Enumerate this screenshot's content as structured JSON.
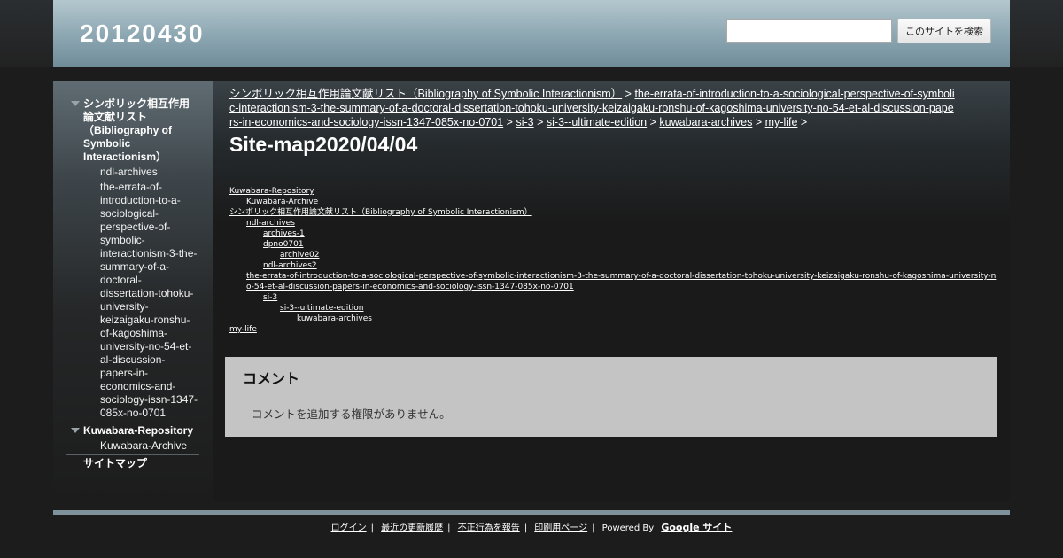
{
  "header": {
    "site_title": "20120430",
    "search_value": "",
    "search_button": "このサイトを検索"
  },
  "sidebar": {
    "items": [
      {
        "label": "シンボリック相互作用論文献リスト（Bibliography of Symbolic Interactionism）",
        "expanded": true,
        "children": [
          "ndl-archives",
          "the-errata-of-introduction-to-a-sociological-perspective-of-symbolic-interactionism-3-the-summary-of-a-doctoral-dissertation-tohoku-university-keizaigaku-ronshu-of-kagoshima-university-no-54-et-al-discussion-papers-in-economics-and-sociology-issn-1347-085x-no-0701"
        ]
      },
      {
        "label": "Kuwabara-Repository",
        "expanded": true,
        "children": [
          "Kuwabara-Archive"
        ]
      },
      {
        "label": "サイトマップ",
        "expanded": false,
        "children": []
      }
    ]
  },
  "breadcrumb": {
    "links": [
      "シンボリック相互作用論文献リスト（Bibliography of Symbolic Interactionism）",
      "the-errata-of-introduction-to-a-sociological-perspective-of-symbolic-interactionism-3-the-summary-of-a-doctoral-dissertation-tohoku-university-keizaigaku-ronshu-of-kagoshima-university-no-54-et-al-discussion-papers-in-economics-and-sociology-issn-1347-085x-no-0701",
      "si-3",
      "si-3--ultimate-edition",
      "kuwabara-archives",
      "my-life"
    ],
    "separator": ">"
  },
  "page_title": "Site-map2020/04/04",
  "sitemap": [
    {
      "label": "Kuwabara-Repository",
      "depth": 0
    },
    {
      "label": "Kuwabara-Archive",
      "depth": 1
    },
    {
      "label": "シンボリック相互作用論文献リスト（Bibliography of Symbolic Interactionism）",
      "depth": 0
    },
    {
      "label": "ndl-archives",
      "depth": 1
    },
    {
      "label": "archives-1",
      "depth": 2
    },
    {
      "label": "dpno0701",
      "depth": 2
    },
    {
      "label": "archive02",
      "depth": 3
    },
    {
      "label": "ndl-archives2",
      "depth": 2
    },
    {
      "label": "the-errata-of-introduction-to-a-sociological-perspective-of-symbolic-interactionism-3-the-summary-of-a-doctoral-dissertation-tohoku-university-keizaigaku-ronshu-of-kagoshima-university-no-54-et-al-discussion-papers-in-economics-and-sociology-issn-1347-085x-no-0701",
      "depth": 1
    },
    {
      "label": "si-3",
      "depth": 2
    },
    {
      "label": "si-3--ultimate-edition",
      "depth": 3
    },
    {
      "label": "kuwabara-archives",
      "depth": 4
    },
    {
      "label": "my-life",
      "depth": 0
    }
  ],
  "comments": {
    "title": "コメント",
    "message": "コメントを追加する権限がありません。"
  },
  "footer": {
    "links": [
      "ログイン",
      "最近の更新履歴",
      "不正行為を報告",
      "印刷用ページ"
    ],
    "powered_by": "Powered By",
    "google_sites": "Google サイト"
  }
}
